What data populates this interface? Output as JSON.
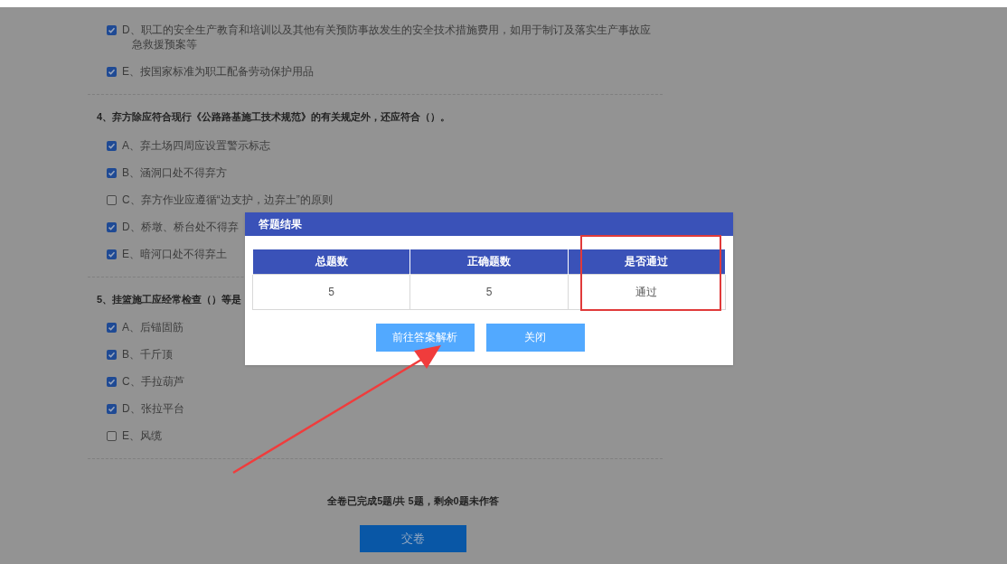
{
  "questions": [
    {
      "options": [
        {
          "label": "D、职工的安全生产教育和培训以及其他有关预防事故发生的安全技术措施费用，如用于制订及落实生产事故应急救援预案等",
          "checked": true
        },
        {
          "label": "E、按国家标准为职工配备劳动保护用品",
          "checked": true
        }
      ]
    },
    {
      "title": "4、弃方除应符合现行《公路路基施工技术规范》的有关规定外，还应符合（）。",
      "options": [
        {
          "label": "A、弃土场四周应设置警示标志",
          "checked": true
        },
        {
          "label": "B、涵洞口处不得弃方",
          "checked": true
        },
        {
          "label": "C、弃方作业应遵循“边支护，边弃土”的原则",
          "checked": false
        },
        {
          "label": "D、桥墩、桥台处不得弃",
          "checked": true
        },
        {
          "label": "E、暗河口处不得弃土",
          "checked": true
        }
      ]
    },
    {
      "title": "5、挂篮施工应经常检查（）等是",
      "options": [
        {
          "label": "A、后锚固筋",
          "checked": true
        },
        {
          "label": "B、千斤顶",
          "checked": true
        },
        {
          "label": "C、手拉葫芦",
          "checked": true
        },
        {
          "label": "D、张拉平台",
          "checked": true
        },
        {
          "label": "E、风缆",
          "checked": false
        }
      ]
    }
  ],
  "summary": "全卷已完成5题/共 5题，剩余0题未作答",
  "submit_button": "交卷",
  "dialog": {
    "title": "答题结果",
    "table": {
      "columns": [
        "总题数",
        "正确题数",
        "是否通过"
      ],
      "rows": [
        [
          "5",
          "5",
          "通过"
        ]
      ]
    },
    "buttons": [
      "前往答案解析",
      "关闭"
    ]
  }
}
